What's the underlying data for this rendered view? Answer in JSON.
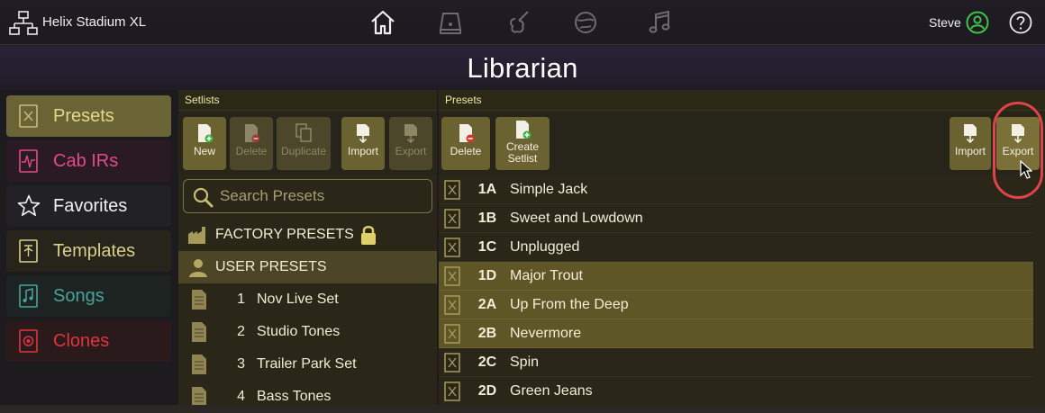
{
  "app": {
    "title": "Helix Stadium XL",
    "nav_icons": [
      "home-icon",
      "amp-icon",
      "guitar-icon",
      "globe-icon",
      "music-note-icon"
    ],
    "user": "Steve",
    "help_icon": "help-icon"
  },
  "page_title": "Librarian",
  "colors": {
    "accent": "#f2e9a8",
    "button": "#6b6232",
    "selected_row": "#5e5627",
    "highlight": "#e0434a"
  },
  "left_nav": [
    {
      "label": "Presets",
      "icon": "preset-icon",
      "color": "#e5d88a",
      "bg": "#6a6335"
    },
    {
      "label": "Cab IRs",
      "icon": "cab-ir-icon",
      "color": "#e24b8b",
      "bg": "#2a1a24"
    },
    {
      "label": "Favorites",
      "icon": "star-icon",
      "color": "#f0f0f0",
      "bg": "#222125"
    },
    {
      "label": "Templates",
      "icon": "template-icon",
      "color": "#d8cf8a",
      "bg": "#26241b"
    },
    {
      "label": "Songs",
      "icon": "song-icon",
      "color": "#4aa39a",
      "bg": "#1c2321"
    },
    {
      "label": "Clones",
      "icon": "clone-icon",
      "color": "#e2343e",
      "bg": "#2a1a1c"
    }
  ],
  "setlists": {
    "header": "Setlists",
    "toolbar": [
      {
        "label": "New",
        "icon": "new-icon",
        "enabled": true
      },
      {
        "label": "Delete",
        "icon": "delete-icon",
        "enabled": false
      },
      {
        "label": "Duplicate",
        "icon": "duplicate-icon",
        "enabled": false
      },
      {
        "label": "Import",
        "icon": "import-icon",
        "enabled": true
      },
      {
        "label": "Export",
        "icon": "export-icon",
        "enabled": false
      }
    ],
    "search_placeholder": "Search Presets",
    "factory_label": "FACTORY PRESETS",
    "user_label": "USER PRESETS",
    "items": [
      {
        "num": "1",
        "name": "Nov Live Set"
      },
      {
        "num": "2",
        "name": "Studio Tones"
      },
      {
        "num": "3",
        "name": "Trailer Park Set"
      },
      {
        "num": "4",
        "name": "Bass Tones"
      }
    ]
  },
  "presets": {
    "header": "Presets",
    "toolbar_left": [
      {
        "label": "Delete",
        "icon": "delete-icon"
      },
      {
        "label": "Create Setlist",
        "icon": "create-setlist-icon"
      }
    ],
    "toolbar_right": [
      {
        "label": "Import",
        "icon": "import-icon"
      },
      {
        "label": "Export",
        "icon": "export-icon"
      }
    ],
    "rows": [
      {
        "id": "1A",
        "name": "Simple Jack",
        "selected": false
      },
      {
        "id": "1B",
        "name": "Sweet and Lowdown",
        "selected": false
      },
      {
        "id": "1C",
        "name": "Unplugged",
        "selected": false
      },
      {
        "id": "1D",
        "name": "Major Trout",
        "selected": true
      },
      {
        "id": "2A",
        "name": "Up From the Deep",
        "selected": true
      },
      {
        "id": "2B",
        "name": "Nevermore",
        "selected": true
      },
      {
        "id": "2C",
        "name": "Spin",
        "selected": false
      },
      {
        "id": "2D",
        "name": "Green Jeans",
        "selected": false
      }
    ]
  }
}
